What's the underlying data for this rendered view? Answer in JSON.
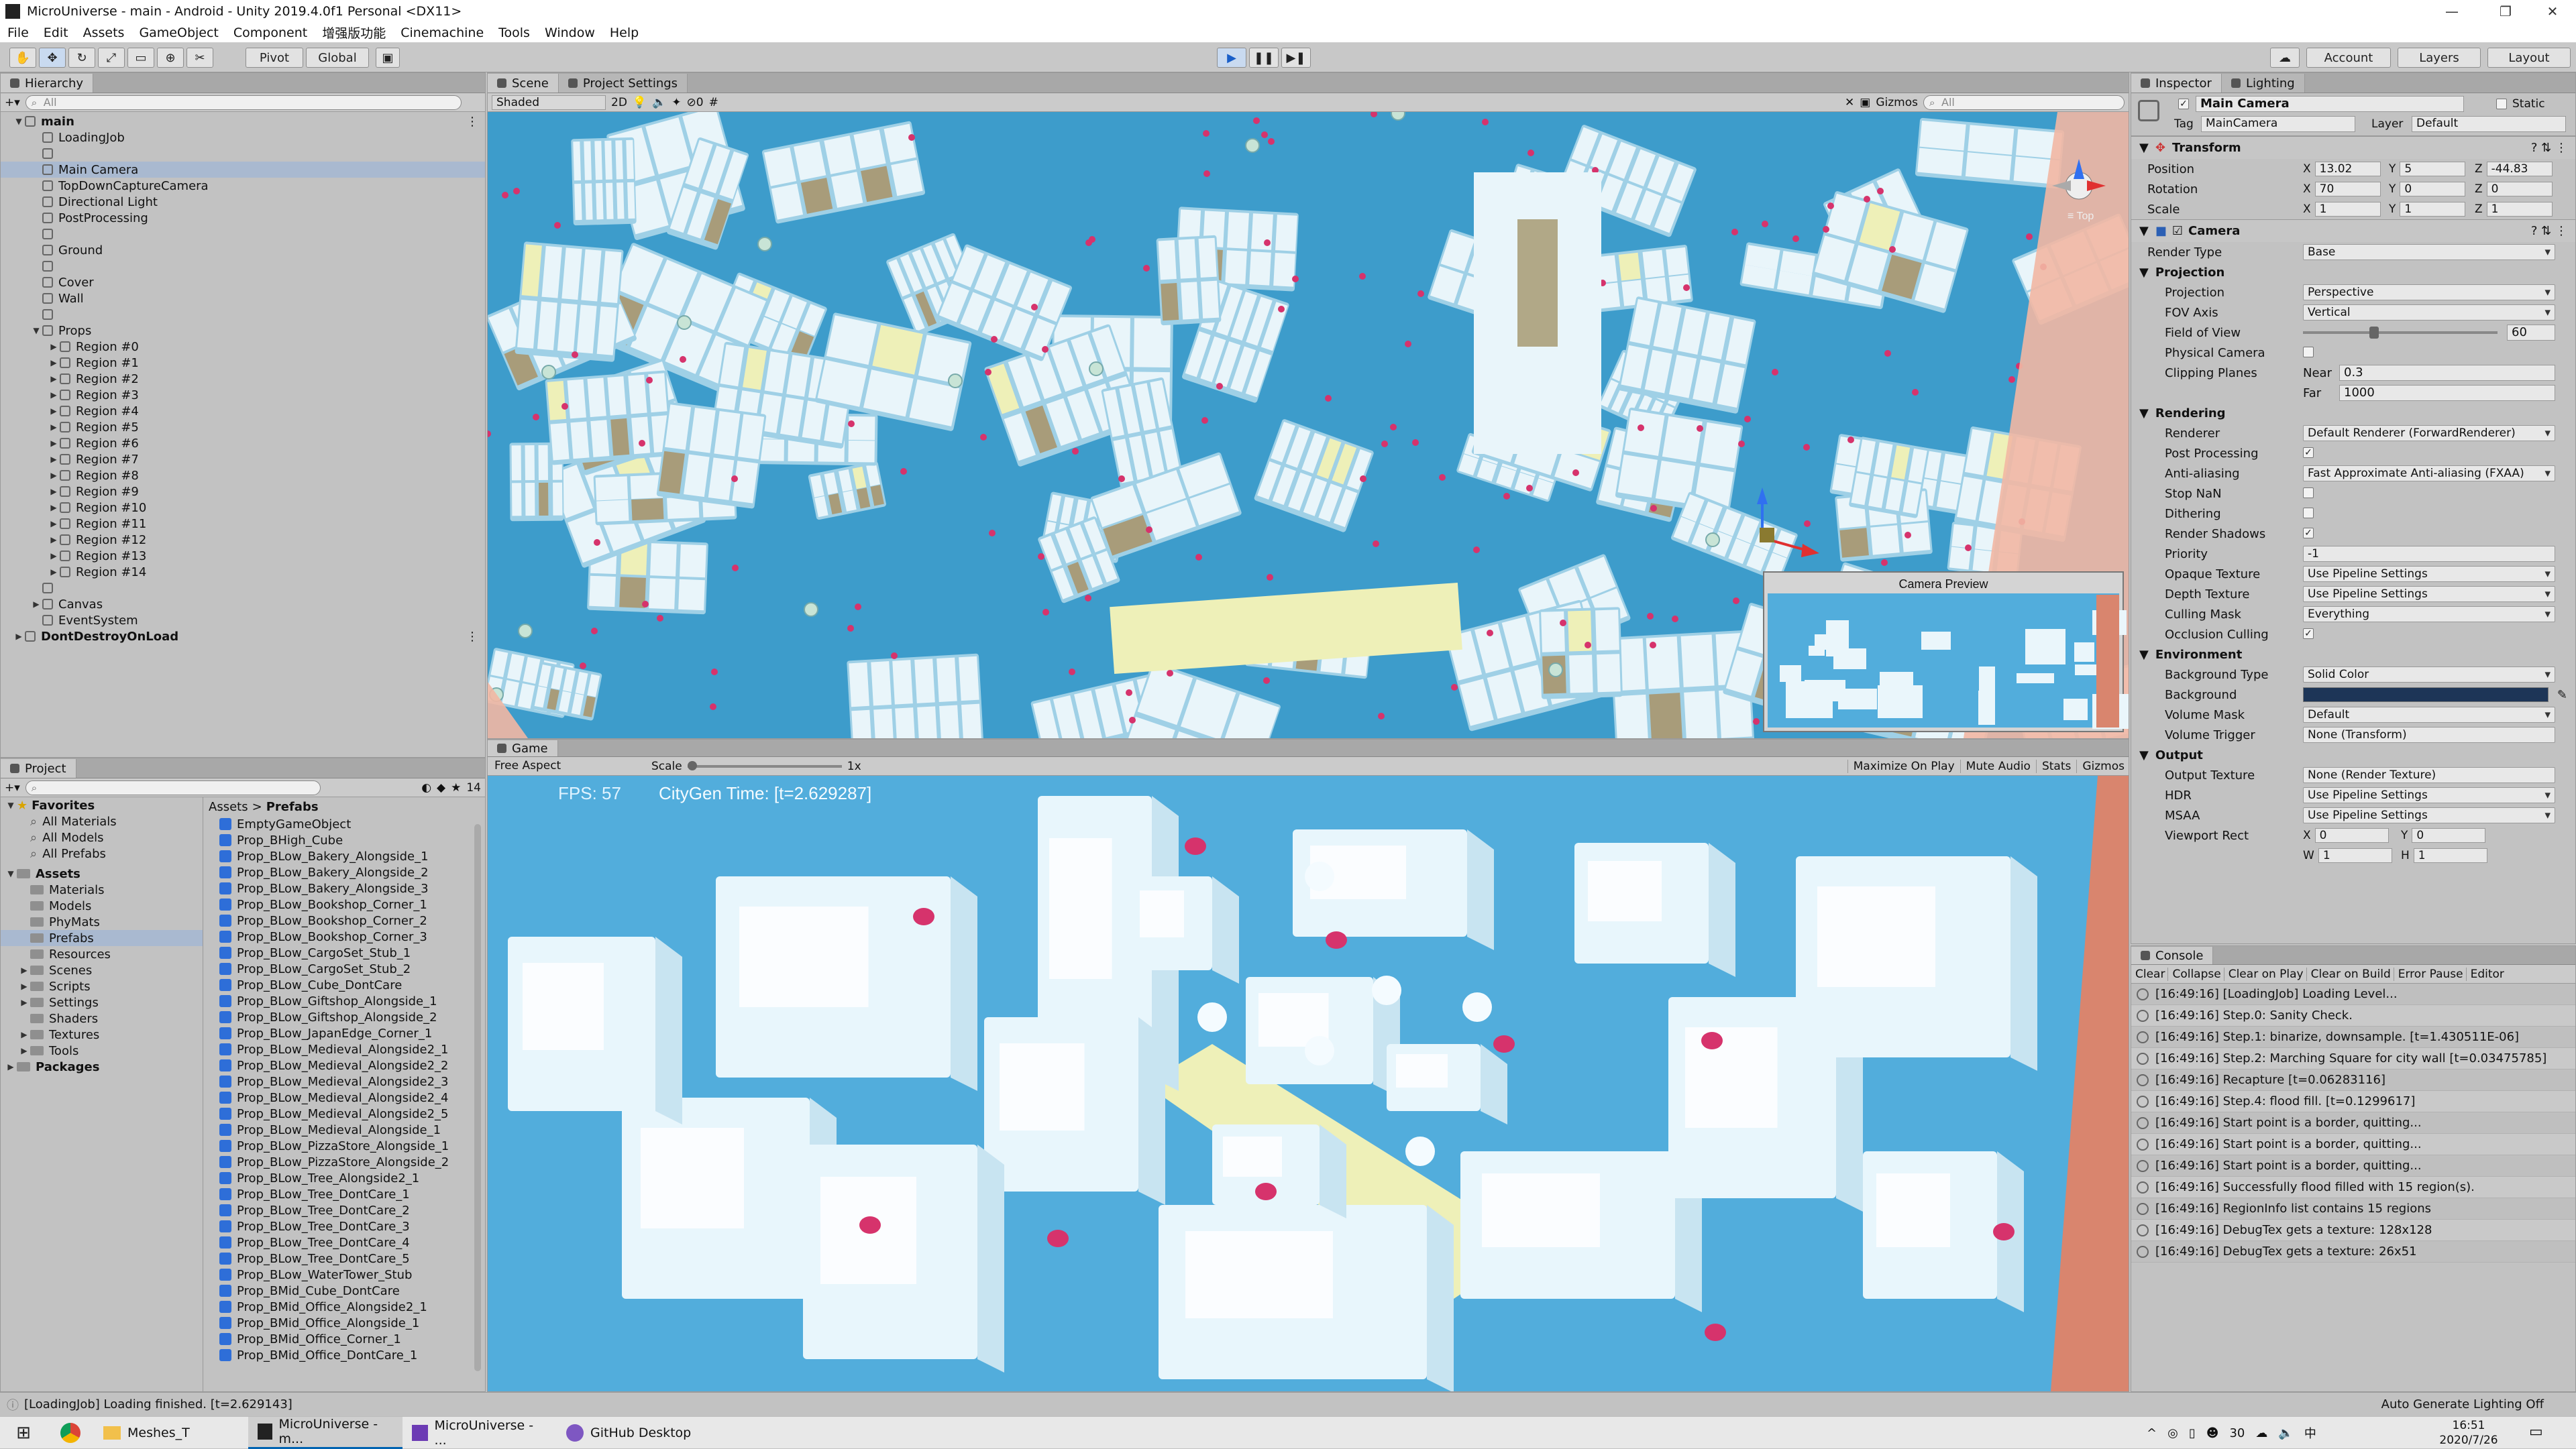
{
  "window": {
    "title": "MicroUniverse - main - Android - Unity 2019.4.0f1 Personal <DX11>"
  },
  "menu": [
    "File",
    "Edit",
    "Assets",
    "GameObject",
    "Component",
    "增强版功能",
    "Cinemachine",
    "Tools",
    "Window",
    "Help"
  ],
  "toolbar": {
    "pivot": "Pivot",
    "global": "Global",
    "account": "Account",
    "layers": "Layers",
    "layout": "Layout"
  },
  "hierarchy": {
    "tab": "Hierarchy",
    "search_placeholder": "All",
    "rows": [
      {
        "text": "main",
        "indent": 0,
        "arrow": "▼",
        "scene": true
      },
      {
        "text": "LoadingJob",
        "indent": 1
      },
      {
        "text": "",
        "indent": 1
      },
      {
        "text": "Main Camera",
        "indent": 1,
        "selected": true
      },
      {
        "text": "TopDownCaptureCamera",
        "indent": 1
      },
      {
        "text": "Directional Light",
        "indent": 1
      },
      {
        "text": "PostProcessing",
        "indent": 1
      },
      {
        "text": "",
        "indent": 1
      },
      {
        "text": "Ground",
        "indent": 1
      },
      {
        "text": "",
        "indent": 1
      },
      {
        "text": "Cover",
        "indent": 1
      },
      {
        "text": "Wall",
        "indent": 1
      },
      {
        "text": "",
        "indent": 1
      },
      {
        "text": "Props",
        "indent": 1,
        "arrow": "▼"
      },
      {
        "text": "Region #0",
        "indent": 2,
        "arrow": "▶"
      },
      {
        "text": "Region #1",
        "indent": 2,
        "arrow": "▶"
      },
      {
        "text": "Region #2",
        "indent": 2,
        "arrow": "▶"
      },
      {
        "text": "Region #3",
        "indent": 2,
        "arrow": "▶"
      },
      {
        "text": "Region #4",
        "indent": 2,
        "arrow": "▶"
      },
      {
        "text": "Region #5",
        "indent": 2,
        "arrow": "▶"
      },
      {
        "text": "Region #6",
        "indent": 2,
        "arrow": "▶"
      },
      {
        "text": "Region #7",
        "indent": 2,
        "arrow": "▶"
      },
      {
        "text": "Region #8",
        "indent": 2,
        "arrow": "▶"
      },
      {
        "text": "Region #9",
        "indent": 2,
        "arrow": "▶"
      },
      {
        "text": "Region #10",
        "indent": 2,
        "arrow": "▶"
      },
      {
        "text": "Region #11",
        "indent": 2,
        "arrow": "▶"
      },
      {
        "text": "Region #12",
        "indent": 2,
        "arrow": "▶"
      },
      {
        "text": "Region #13",
        "indent": 2,
        "arrow": "▶"
      },
      {
        "text": "Region #14",
        "indent": 2,
        "arrow": "▶"
      },
      {
        "text": "",
        "indent": 1
      },
      {
        "text": "Canvas",
        "indent": 1,
        "arrow": "▶"
      },
      {
        "text": "EventSystem",
        "indent": 1
      },
      {
        "text": "DontDestroyOnLoad",
        "indent": 0,
        "arrow": "▶",
        "scene": true
      }
    ]
  },
  "project": {
    "tab": "Project",
    "count": "14",
    "favorites": {
      "label": "Favorites",
      "items": [
        "All Materials",
        "All Models",
        "All Prefabs"
      ]
    },
    "assets": {
      "label": "Assets",
      "items": [
        "Materials",
        "Models",
        "PhyMats",
        "Prefabs",
        "Resources",
        "Scenes",
        "Scripts",
        "Settings",
        "Shaders",
        "Textures",
        "Tools"
      ]
    },
    "packages": "Packages",
    "breadcrumb": [
      "Assets",
      "Prefabs"
    ],
    "files": [
      "EmptyGameObject",
      "Prop_BHigh_Cube",
      "Prop_BLow_Bakery_Alongside_1",
      "Prop_BLow_Bakery_Alongside_2",
      "Prop_BLow_Bakery_Alongside_3",
      "Prop_BLow_Bookshop_Corner_1",
      "Prop_BLow_Bookshop_Corner_2",
      "Prop_BLow_Bookshop_Corner_3",
      "Prop_BLow_CargoSet_Stub_1",
      "Prop_BLow_CargoSet_Stub_2",
      "Prop_BLow_Cube_DontCare",
      "Prop_BLow_Giftshop_Alongside_1",
      "Prop_BLow_Giftshop_Alongside_2",
      "Prop_BLow_JapanEdge_Corner_1",
      "Prop_BLow_Medieval_Alongside2_1",
      "Prop_BLow_Medieval_Alongside2_2",
      "Prop_BLow_Medieval_Alongside2_3",
      "Prop_BLow_Medieval_Alongside2_4",
      "Prop_BLow_Medieval_Alongside2_5",
      "Prop_BLow_Medieval_Alongside_1",
      "Prop_BLow_PizzaStore_Alongside_1",
      "Prop_BLow_PizzaStore_Alongside_2",
      "Prop_BLow_Tree_Alongside2_1",
      "Prop_BLow_Tree_DontCare_1",
      "Prop_BLow_Tree_DontCare_2",
      "Prop_BLow_Tree_DontCare_3",
      "Prop_BLow_Tree_DontCare_4",
      "Prop_BLow_Tree_DontCare_5",
      "Prop_BLow_WaterTower_Stub",
      "Prop_BMid_Cube_DontCare",
      "Prop_BMid_Office_Alongside2_1",
      "Prop_BMid_Office_Alongside_1",
      "Prop_BMid_Office_Corner_1",
      "Prop_BMid_Office_DontCare_1"
    ]
  },
  "scene": {
    "tabs": [
      "Scene",
      "Project Settings"
    ],
    "shading": "Shaded",
    "mode_2d": "2D",
    "hidden_count": "0",
    "gizmos": "Gizmos",
    "search": "All",
    "persp": "≡ Top",
    "preview_title": "Camera Preview"
  },
  "game": {
    "tab": "Game",
    "aspect": "Free Aspect",
    "scale_label": "Scale",
    "scale_value": "1x",
    "buttons": [
      "Maximize On Play",
      "Mute Audio",
      "Stats",
      "Gizmos"
    ],
    "fps": "FPS: 57",
    "citygen": "CityGen Time:  [t=2.629287]"
  },
  "inspector": {
    "tabs": [
      "Inspector",
      "Lighting"
    ],
    "object_name": "Main Camera",
    "static": "Static",
    "tag_label": "Tag",
    "tag": "MainCamera",
    "layer_label": "Layer",
    "layer": "Default",
    "transform": {
      "title": "Transform",
      "position": {
        "label": "Position",
        "x": "13.02",
        "y": "5",
        "z": "-44.83"
      },
      "rotation": {
        "label": "Rotation",
        "x": "70",
        "y": "0",
        "z": "0"
      },
      "scale": {
        "label": "Scale",
        "x": "1",
        "y": "1",
        "z": "1"
      }
    },
    "camera": {
      "title": "Camera",
      "render_type_label": "Render Type",
      "render_type": "Base",
      "projection_head": "Projection",
      "projection_label": "Projection",
      "projection": "Perspective",
      "fov_axis_label": "FOV Axis",
      "fov_axis": "Vertical",
      "fov_label": "Field of View",
      "fov": "60",
      "fov_fraction": 0.34,
      "physical_label": "Physical Camera",
      "clipping_label": "Clipping Planes",
      "near_label": "Near",
      "near": "0.3",
      "far_label": "Far",
      "far": "1000",
      "rendering_head": "Rendering",
      "renderer_label": "Renderer",
      "renderer": "Default Renderer (ForwardRenderer)",
      "postproc_label": "Post Processing",
      "aa_label": "Anti-aliasing",
      "aa": "Fast Approximate Anti-aliasing (FXAA)",
      "stopnan_label": "Stop NaN",
      "dither_label": "Dithering",
      "shadows_label": "Render Shadows",
      "priority_label": "Priority",
      "priority": "-1",
      "opaque_label": "Opaque Texture",
      "opaque": "Use Pipeline Settings",
      "depth_label": "Depth Texture",
      "depth": "Use Pipeline Settings",
      "culling_label": "Culling Mask",
      "culling": "Everything",
      "occlusion_label": "Occlusion Culling",
      "env_head": "Environment",
      "bgtype_label": "Background Type",
      "bgtype": "Solid Color",
      "bg_label": "Background",
      "bg_color": "#1d3557",
      "volmask_label": "Volume Mask",
      "volmask": "Default",
      "voltrig_label": "Volume Trigger",
      "voltrig": "None (Transform)",
      "out_head": "Output",
      "outtex_label": "Output Texture",
      "outtex": "None (Render Texture)",
      "hdr_label": "HDR",
      "hdr": "Use Pipeline Settings",
      "msaa_label": "MSAA",
      "msaa": "Use Pipeline Settings",
      "viewport_label": "Viewport Rect",
      "vx": "0",
      "vy": "0",
      "vw": "1",
      "vh": "1"
    }
  },
  "console": {
    "tab": "Console",
    "buttons": [
      "Clear",
      "Collapse",
      "Clear on Play",
      "Clear on Build",
      "Error Pause",
      "Editor"
    ],
    "lines": [
      "[16:49:16] [LoadingJob] Loading Level...",
      "[16:49:16] Step.0: Sanity Check.",
      "[16:49:16] Step.1: binarize, downsample. [t=1.430511E-06]",
      "[16:49:16] Step.2: Marching Square for city wall [t=0.03475785]",
      "[16:49:16] Recapture [t=0.06283116]",
      "[16:49:16] Step.4: flood fill. [t=0.1299617]",
      "[16:49:16] Start point is a border, quitting...",
      "[16:49:16] Start point is a border, quitting...",
      "[16:49:16] Start point is a border, quitting...",
      "[16:49:16] Successfully flood filled with 15 region(s).",
      "[16:49:16] RegionInfo list contains 15 regions",
      "[16:49:16] DebugTex gets a texture: 128x128",
      "[16:49:16] DebugTex gets a texture: 26x51"
    ]
  },
  "status": {
    "left": "[LoadingJob] Loading finished. [t=2.629143]",
    "right": "Auto Generate Lighting Off"
  },
  "taskbar": {
    "items": [
      "Meshes_T",
      "MicroUniverse - m...",
      "MicroUniverse - ...",
      "GitHub Desktop"
    ],
    "tray_num": "30",
    "time": "16:51",
    "date": "2020/7/26"
  },
  "colors": {
    "scene_water": "#3d9ccb",
    "building": "#e9f5fa",
    "game_sky": "#52addc",
    "dot": "#d6336c",
    "selection": "#a9b9d0"
  }
}
